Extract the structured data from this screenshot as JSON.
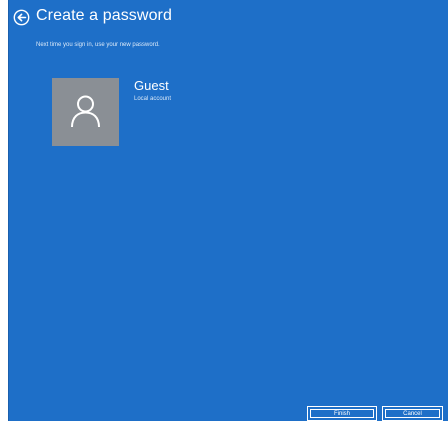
{
  "header": {
    "title": "Create a password",
    "subtitle": "Next time you sign in, use your new password."
  },
  "account": {
    "name": "Guest",
    "type": "Local account",
    "avatar_icon": "user-icon"
  },
  "footer": {
    "finish_label": "Finish",
    "cancel_label": "Cancel"
  },
  "colors": {
    "background": "#1e6fc8",
    "avatar": "#8a8f95",
    "text": "#ffffff"
  },
  "icons": {
    "back": "back-arrow-icon"
  }
}
